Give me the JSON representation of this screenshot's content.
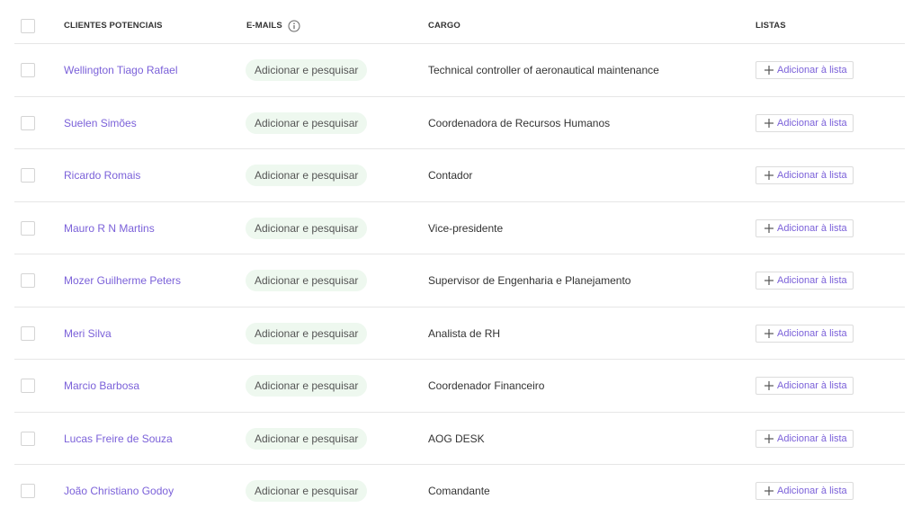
{
  "header": {
    "col_name": "CLIENTES POTENCIAIS",
    "col_email": "E-MAILS",
    "col_cargo": "CARGO",
    "col_listas": "LISTAS"
  },
  "rows": [
    {
      "name": "Wellington Tiago Rafael",
      "email_action": "Adicionar e pesquisar",
      "cargo": "Technical controller of aeronautical maintenance",
      "list_action": "Adicionar à lista"
    },
    {
      "name": "Suelen Simões",
      "email_action": "Adicionar e pesquisar",
      "cargo": "Coordenadora de Recursos Humanos",
      "list_action": "Adicionar à lista"
    },
    {
      "name": "Ricardo Romais",
      "email_action": "Adicionar e pesquisar",
      "cargo": "Contador",
      "list_action": "Adicionar à lista"
    },
    {
      "name": "Mauro R N Martins",
      "email_action": "Adicionar e pesquisar",
      "cargo": "Vice-presidente",
      "list_action": "Adicionar à lista"
    },
    {
      "name": "Mozer Guilherme Peters",
      "email_action": "Adicionar e pesquisar",
      "cargo": "Supervisor de Engenharia e Planejamento",
      "list_action": "Adicionar à lista"
    },
    {
      "name": "Meri Silva",
      "email_action": "Adicionar e pesquisar",
      "cargo": "Analista de RH",
      "list_action": "Adicionar à lista"
    },
    {
      "name": "Marcio Barbosa",
      "email_action": "Adicionar e pesquisar",
      "cargo": "Coordenador Financeiro",
      "list_action": "Adicionar à lista"
    },
    {
      "name": "Lucas Freire de Souza",
      "email_action": "Adicionar e pesquisar",
      "cargo": "AOG DESK",
      "list_action": "Adicionar à lista"
    },
    {
      "name": "João Christiano Godoy",
      "email_action": "Adicionar e pesquisar",
      "cargo": "Comandante",
      "list_action": "Adicionar à lista"
    }
  ],
  "colors": {
    "accent": "#7b61d9",
    "pill_bg": "#eef8ef",
    "divider": "#e6e6e6"
  },
  "icons": {
    "info": "info-circle-icon",
    "plus": "plus-icon"
  }
}
